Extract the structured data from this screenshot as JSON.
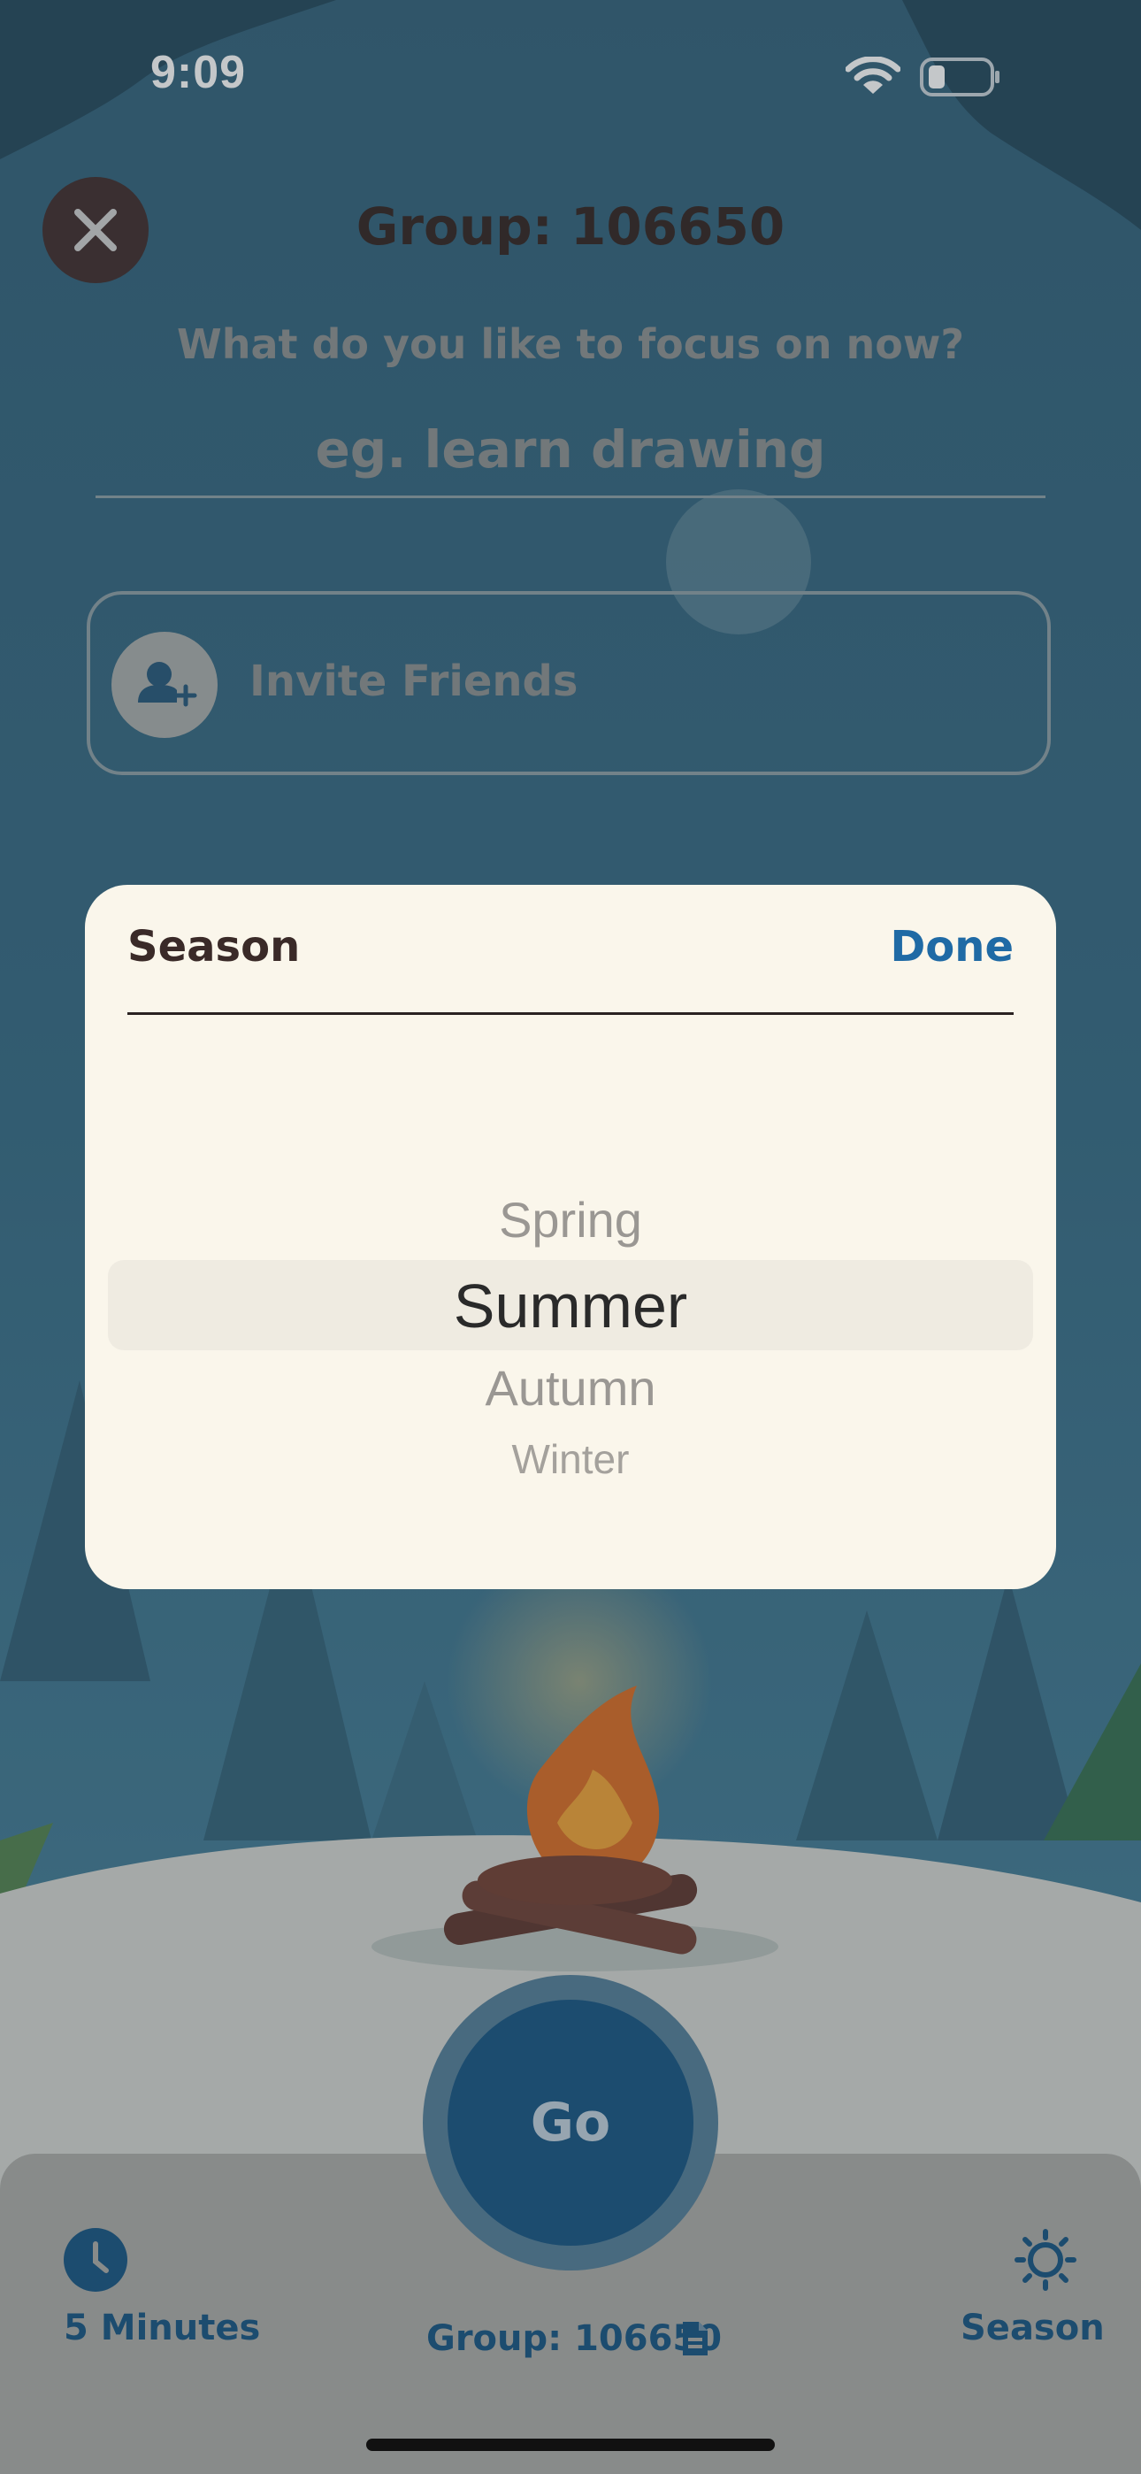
{
  "status_bar": {
    "time": "9:09"
  },
  "header": {
    "group_title": "Group: 106650"
  },
  "focus": {
    "prompt": "What do you like to focus on now?",
    "placeholder": "eg. learn drawing"
  },
  "invite": {
    "label": "Invite Friends"
  },
  "season_picker": {
    "title": "Season",
    "done_label": "Done",
    "options": [
      "Spring",
      "Summer",
      "Autumn",
      "Winter"
    ],
    "selected": "Summer"
  },
  "bottom_bar": {
    "timer_label": "5 Minutes",
    "group_label": "Group: 106650",
    "season_label": "Season",
    "go_label": "Go"
  },
  "icons": {
    "close": "close-icon",
    "add_user": "add-user-icon",
    "clock": "clock-icon",
    "copy": "copy-icon",
    "sun": "sun-icon",
    "wifi": "wifi-icon",
    "battery": "battery-icon"
  },
  "colors": {
    "accent": "#1f6aa5",
    "go_button": "#0f4f7f",
    "modal_bg": "#faf6eb"
  }
}
